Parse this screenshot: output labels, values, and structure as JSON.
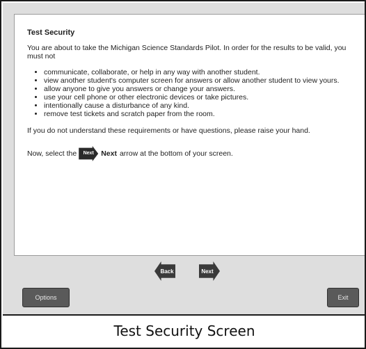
{
  "page": {
    "heading": "Test Security",
    "intro": "You are about to take the Michigan Science Standards Pilot. In order for the results to be valid, you must not",
    "rules": [
      "communicate, collaborate, or help in any way with another student.",
      "view another student's computer screen for answers or allow another student to view yours.",
      "allow anyone to give you answers or change your answers.",
      "use your cell phone or other electronic devices or take pictures.",
      "intentionally cause a disturbance of any kind.",
      "remove test tickets and scratch paper from the room."
    ],
    "note": "If you do not understand these requirements or have questions, please raise your hand.",
    "instruction": {
      "prefix": "Now, select the",
      "icon_label": "Next",
      "bold_word": "Next",
      "suffix": "arrow at the bottom of your screen."
    }
  },
  "nav": {
    "back_label": "Back",
    "next_label": "Next"
  },
  "footer": {
    "options_label": "Options",
    "exit_label": "Exit"
  },
  "caption": "Test Security Screen"
}
